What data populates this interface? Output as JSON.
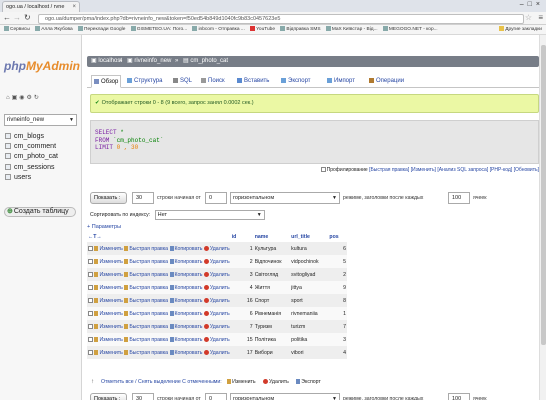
{
  "browser": {
    "tab_title": "ogo.ua / localhost / rvne",
    "url": "ogo.ua/dumper/pma/index.php?db=rivneinfo_new&token=f50ed54b849d1040fc9b83c0457623e5",
    "bookmarks": [
      "Сервисы",
      "Алла Якубова",
      "Переклади Google",
      "GISMETEO.UA: Пого...",
      "inbcom - Отправка ...",
      "YouTube",
      "Відправка SMS",
      "MaX Київстар - Від...",
      "MEGOGO.NET - кор...",
      "Другие закладки"
    ]
  },
  "sidebar": {
    "logo_php": "php",
    "logo_myadmin": "MyAdmin",
    "db_selected": "rivneinfo_new",
    "tables": [
      "cm_blogs",
      "cm_comment",
      "cm_photo_cat",
      "cm_sessions",
      "users"
    ],
    "new_table": "Создать таблицу"
  },
  "breadcrumb": [
    "localhost",
    "rivneinfo_new",
    "cm_photo_cat"
  ],
  "menu": [
    "Обзор",
    "Структура",
    "SQL",
    "Поиск",
    "Вставить",
    "Экспорт",
    "Импорт",
    "Операции"
  ],
  "success_msg": "Отображает строки 0 - 8 (9 всего, запрос занял 0.0002 сек.)",
  "sql": {
    "select": "SELECT",
    "star": "*",
    "from": "FROM",
    "table": "`cm_photo_cat`",
    "limit": "LIMIT",
    "limit_vals": "0 , 30"
  },
  "sql_links": {
    "profiling": "Профилирование",
    "fast_edit": "[Быстрая правка]",
    "edit": "[Изменить]",
    "analyze": "[Анализ SQL запроса]",
    "php": "[PHP-код]",
    "refresh": "[Обновить]"
  },
  "nav": {
    "show_btn": "Показать :",
    "rows": "30",
    "rows_from_label": "строки начиная от",
    "from": "0",
    "mode": "горизонтальном",
    "mode_label": "режиме, заголовки после каждых",
    "every": "100",
    "cells_label": "ячеек"
  },
  "sort": {
    "label": "Сортировать по индексу:",
    "value": "Нет"
  },
  "options_label": "+ Параметры",
  "columns": [
    "id",
    "name",
    "url_title",
    "pos"
  ],
  "actions": {
    "edit": "Изменить",
    "quick": "Быстрая правка",
    "copy": "Копировать",
    "delete": "Удалить"
  },
  "rows": [
    {
      "id": "1",
      "name": "Культура",
      "url_title": "kultura",
      "pos": "6"
    },
    {
      "id": "2",
      "name": "Відпочинок",
      "url_title": "vidpochinok",
      "pos": "5"
    },
    {
      "id": "3",
      "name": "Світогляд",
      "url_title": "svitogliyad",
      "pos": "2"
    },
    {
      "id": "4",
      "name": "Життя",
      "url_title": "jittya",
      "pos": "9"
    },
    {
      "id": "16",
      "name": "Спорт",
      "url_title": "sport",
      "pos": "8"
    },
    {
      "id": "6",
      "name": "Рівнеманія",
      "url_title": "rivnemaniia",
      "pos": "1"
    },
    {
      "id": "7",
      "name": "Туризм",
      "url_title": "turizm",
      "pos": "7"
    },
    {
      "id": "15",
      "name": "Політика",
      "url_title": "politika",
      "pos": "3"
    },
    {
      "id": "17",
      "name": "Вибори",
      "url_title": "vibori",
      "pos": "4"
    }
  ],
  "bulk": {
    "check_all": "Отметить все / Снять выделение С отмеченными:",
    "edit": "Изменить",
    "delete": "Удалить",
    "export": "Экспорт"
  }
}
